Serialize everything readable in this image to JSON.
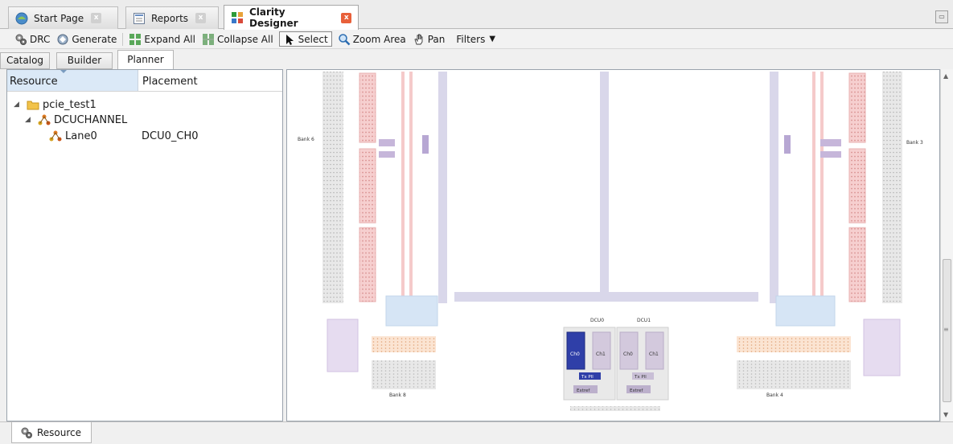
{
  "editor_tabs": [
    {
      "label": "Start Page",
      "icon": "start-page-icon"
    },
    {
      "label": "Reports",
      "icon": "reports-icon"
    },
    {
      "label": "Clarity Designer",
      "icon": "clarity-designer-icon"
    }
  ],
  "toolbar": {
    "drc": "DRC",
    "generate": "Generate",
    "expand_all": "Expand All",
    "collapse_all": "Collapse All",
    "select": "Select",
    "zoom_area": "Zoom Area",
    "pan": "Pan",
    "filters": "Filters"
  },
  "view_tabs": [
    "Catalog",
    "Builder",
    "Planner"
  ],
  "resource_panel": {
    "col_resource": "Resource",
    "col_placement": "Placement",
    "tree": [
      {
        "label": "pcie_test1",
        "level": 0,
        "icon": "folder-icon",
        "placement": ""
      },
      {
        "label": "DCUCHANNEL",
        "level": 1,
        "icon": "dcu-channel-icon",
        "placement": ""
      },
      {
        "label": "Lane0",
        "level": 2,
        "icon": "lane-icon",
        "placement": "DCU0_CH0"
      }
    ]
  },
  "planner": {
    "bank_labels": {
      "bank6": "Bank 6",
      "bank3": "Bank 3",
      "bank8": "Bank 8",
      "bank4": "Bank 4"
    },
    "dcu0": {
      "label": "DCU0",
      "ch0": "Ch0",
      "ch1": "Ch1",
      "txpll": "Tx Pll",
      "extref": "Extref"
    },
    "dcu1": {
      "label": "DCU1",
      "ch0": "Ch0",
      "ch1": "Ch1",
      "txpll": "Tx Pll",
      "extref": "Extref"
    }
  },
  "bottom_tab": {
    "label": "Resource",
    "icon": "resource-icon"
  },
  "colors": {
    "selected_channel": "#2f3fa8",
    "bank_gray": "#e6e6e6",
    "io_pink": "#f4c6c6",
    "routing_lavender": "#d9d7ea",
    "block_blue": "#d6e5f5",
    "block_purple": "#e6dcf0",
    "io_orange": "#fbe3d0",
    "active_tab_close": "#e8603a"
  }
}
